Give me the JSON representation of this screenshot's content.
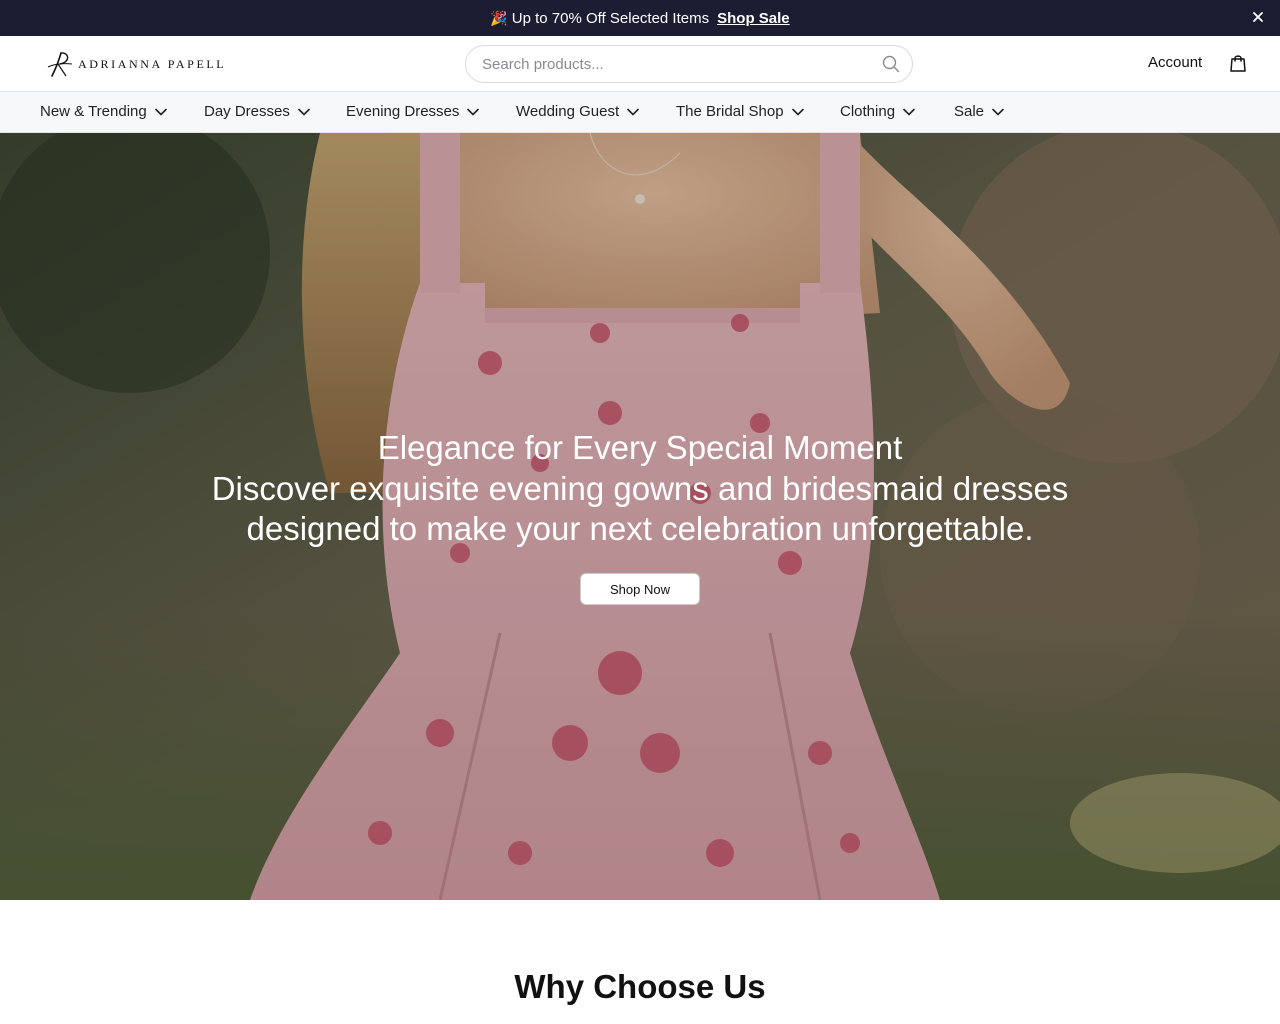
{
  "announcement": {
    "emoji": "🎉",
    "message": "Up to 70% Off Selected Items",
    "link_label": "Shop Sale",
    "bg_color": "#1c1c33"
  },
  "header": {
    "logo_text": "ADRIANNA PAPELL",
    "search_placeholder": "Search products...",
    "account_label": "Account"
  },
  "nav": {
    "items": [
      {
        "label": "New & Trending"
      },
      {
        "label": "Day Dresses"
      },
      {
        "label": "Evening Dresses"
      },
      {
        "label": "Wedding Guest"
      },
      {
        "label": "The Bridal Shop"
      },
      {
        "label": "Clothing"
      },
      {
        "label": "Sale"
      }
    ]
  },
  "hero": {
    "title": "Elegance for Every Special Moment",
    "subtitle": "Discover exquisite evening gowns and bridesmaid dresses designed to make your next celebration unforgettable.",
    "cta_label": "Shop Now"
  },
  "why": {
    "title": "Why Choose Us"
  },
  "icons": {
    "close": "close-icon",
    "search": "search-icon",
    "cart": "shopping-bag-icon",
    "chevron": "chevron-down-icon"
  }
}
